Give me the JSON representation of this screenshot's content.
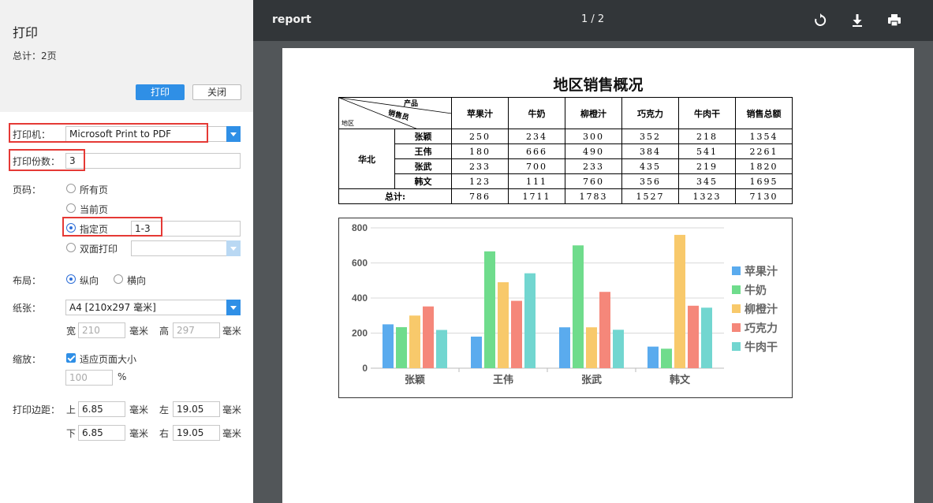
{
  "panel": {
    "title": "打印",
    "total": "总计：2页",
    "print_button": "打印",
    "close_button": "关闭",
    "printer_label": "打印机：",
    "printer_value": "Microsoft Print to PDF",
    "copies_label": "打印份数：",
    "copies_value": "3",
    "pages_label": "页码：",
    "page_options": [
      "所有页",
      "当前页",
      "指定页",
      "双面打印"
    ],
    "page_selected": "指定页",
    "page_range_value": "1-3",
    "layout_label": "布局：",
    "layout_options": [
      "纵向",
      "横向"
    ],
    "layout_selected": "纵向",
    "paper_label": "纸张：",
    "paper_value": "A4 [210x297 毫米]",
    "width_label": "宽",
    "width_value": "210",
    "height_label": "高",
    "height_value": "297",
    "mm_unit": "毫米",
    "scale_label": "缩放：",
    "fit_page_label": "适应页面大小",
    "fit_page_checked": true,
    "scale_value": "100",
    "percent_unit": "%",
    "margin_label": "打印边距：",
    "margin_top_label": "上",
    "margin_top_value": "6.85",
    "margin_left_label": "左",
    "margin_left_value": "19.05",
    "margin_bottom_label": "下",
    "margin_bottom_value": "6.85",
    "margin_right_label": "右",
    "margin_right_value": "19.05"
  },
  "viewer": {
    "doc_title": "report",
    "pager": "1 / 2",
    "icons": [
      "rotate-icon",
      "download-icon",
      "print-icon"
    ]
  },
  "report": {
    "title": "地区销售概况",
    "corner_product": "产品",
    "corner_salesperson": "销售员",
    "corner_region": "地区",
    "columns": [
      "苹果汁",
      "牛奶",
      "柳橙汁",
      "巧克力",
      "牛肉干",
      "销售总额"
    ],
    "region": "华北",
    "rows": [
      {
        "name": "张颖",
        "values": [
          "250",
          "234",
          "300",
          "352",
          "218",
          "1354"
        ]
      },
      {
        "name": "王伟",
        "values": [
          "180",
          "666",
          "490",
          "384",
          "541",
          "2261"
        ]
      },
      {
        "name": "张武",
        "values": [
          "233",
          "700",
          "233",
          "435",
          "219",
          "1820"
        ]
      },
      {
        "name": "韩文",
        "values": [
          "123",
          "111",
          "760",
          "356",
          "345",
          "1695"
        ]
      }
    ],
    "total_label": "总计:",
    "totals": [
      "786",
      "1711",
      "1783",
      "1527",
      "1323",
      "7130"
    ]
  },
  "chart_data": {
    "type": "bar",
    "categories": [
      "张颖",
      "王伟",
      "张武",
      "韩文"
    ],
    "series": [
      {
        "name": "苹果汁",
        "values": [
          250,
          180,
          233,
          123
        ],
        "color": "#5aabee"
      },
      {
        "name": "牛奶",
        "values": [
          234,
          666,
          700,
          111
        ],
        "color": "#6fdc8c"
      },
      {
        "name": "柳橙汁",
        "values": [
          300,
          490,
          233,
          760
        ],
        "color": "#f8c96b"
      },
      {
        "name": "巧克力",
        "values": [
          352,
          384,
          435,
          356
        ],
        "color": "#f5877a"
      },
      {
        "name": "牛肉干",
        "values": [
          218,
          541,
          219,
          345
        ],
        "color": "#72d6d0"
      }
    ],
    "yticks": [
      0,
      200,
      400,
      600,
      800
    ],
    "ylim": [
      0,
      800
    ],
    "grid": true,
    "legend": "right"
  }
}
